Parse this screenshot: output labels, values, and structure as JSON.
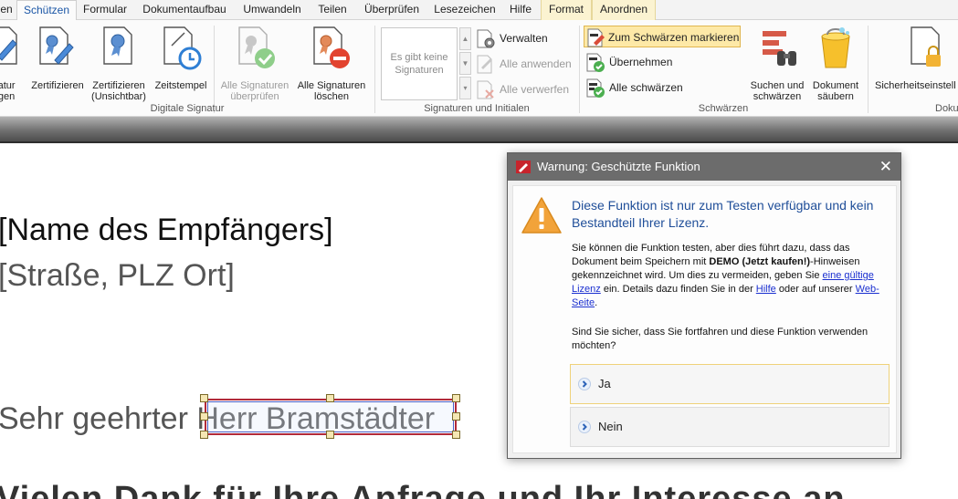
{
  "tabs": [
    {
      "label": "en",
      "active": false
    },
    {
      "label": "Schützen",
      "active": true
    },
    {
      "label": "Formular",
      "active": false
    },
    {
      "label": "Dokumentaufbau",
      "active": false
    },
    {
      "label": "Umwandeln",
      "active": false
    },
    {
      "label": "Teilen",
      "active": false
    },
    {
      "label": "Überprüfen",
      "active": false
    },
    {
      "label": "Lesezeichen",
      "active": false
    },
    {
      "label": "Hilfe",
      "active": false
    },
    {
      "label": "Format",
      "active": false,
      "contextual": true
    },
    {
      "label": "Anordnen",
      "active": false,
      "contextual": true
    }
  ],
  "ribbon": {
    "digital_signature": {
      "group_label": "Digitale Signatur",
      "buttons": [
        {
          "label_line1": "natur",
          "label_line2": "ügen"
        },
        {
          "label_line1": "Zertifizieren",
          "label_line2": ""
        },
        {
          "label_line1": "Zertifizieren",
          "label_line2": "(Unsichtbar)"
        },
        {
          "label_line1": "Zeitstempel",
          "label_line2": ""
        },
        {
          "label_line1": "Alle Signaturen",
          "label_line2": "überprüfen",
          "disabled": true
        },
        {
          "label_line1": "Alle Signaturen",
          "label_line2": "löschen"
        }
      ]
    },
    "signatures_initials": {
      "group_label": "Signaturen und Initialen",
      "empty_box": "Es gibt keine Signaturen",
      "items": [
        {
          "label": "Verwalten",
          "disabled": false
        },
        {
          "label": "Alle anwenden",
          "disabled": true
        },
        {
          "label": "Alle verwerfen",
          "disabled": true
        }
      ]
    },
    "redact": {
      "group_label": "Schwärzen",
      "items": [
        {
          "label": "Zum Schwärzen markieren",
          "highlight": true
        },
        {
          "label": "Übernehmen"
        },
        {
          "label": "Alle schwärzen"
        }
      ],
      "buttons": [
        {
          "label_line1": "Suchen und",
          "label_line2": "schwärzen"
        },
        {
          "label_line1": "Dokument",
          "label_line2": "säubern"
        }
      ]
    },
    "security": {
      "group_label": "Doku",
      "buttons": [
        {
          "label_line1": "Sicherheitseinstell",
          "label_line2": ""
        }
      ]
    }
  },
  "document": {
    "recipient_name": "[Name des Empfängers]",
    "recipient_address": "[Straße, PLZ Ort]",
    "salutation_prefix": "Sehr geehrter ",
    "salutation_selected": "Herr Bramstädter",
    "next_line_partial": "Vielen Dank für Ihre Anfrage und Ihr Interesse an"
  },
  "dialog": {
    "title": "Warnung: Geschützte Funktion",
    "close_glyph": "✕",
    "heading": "Diese Funktion ist nur zum Testen verfügbar und kein Bestandteil Ihrer Lizenz.",
    "para1": {
      "t1": "Sie können die Funktion testen, aber dies führt dazu, dass das Dokument beim Speichern mit ",
      "bold": "DEMO (Jetzt kaufen!)",
      "t2": "-Hinweisen gekennzeichnet wird. Um dies zu vermeiden, geben Sie ",
      "link1": "eine gültige Lizenz",
      "t3": " ein. Details dazu finden Sie in der ",
      "link2": "Hilfe",
      "t4": " oder auf unserer ",
      "link3": "Web-Seite",
      "t5": "."
    },
    "para2": "Sind Sie sicher, dass Sie fortfahren und diese Funktion verwenden möchten?",
    "choices": [
      {
        "label": "Ja",
        "focused": true
      },
      {
        "label": "Nein",
        "focused": false
      }
    ]
  },
  "colors": {
    "accent_blue": "#1f4e99",
    "link": "#1a2fd0",
    "highlight": "#fde9a7",
    "warning_orange": "#f2a33a",
    "selection_border": "#b22a3a"
  }
}
